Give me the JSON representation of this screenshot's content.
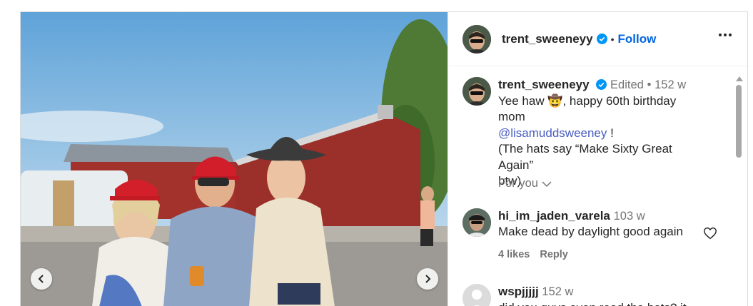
{
  "post": {
    "username": "trent_sweeneyy",
    "dot": "•",
    "follow_label": "Follow"
  },
  "caption": {
    "username": "trent_sweeneyy",
    "edited": "Edited",
    "dot": "•",
    "age": "152 w",
    "text_1": "Yee haw 🤠, happy 60th birthday mom",
    "mention": "@lisamuddsweeney",
    "text_2": " !",
    "text_3": "(The hats say “Make Sixty Great Again”",
    "text_4": "btw)"
  },
  "for_you": "For you",
  "comments": [
    {
      "username": "hi_im_jaden_varela",
      "age": "103 w",
      "text": "Make dead by daylight good again",
      "likes": "4 likes",
      "reply": "Reply"
    },
    {
      "username": "wspjjjjj",
      "age": "152 w",
      "text": "did you guys even read the hats? it"
    }
  ],
  "colors": {
    "follow": "#0064e0",
    "mention": "#4a5ec0",
    "verified": "#0095f6"
  }
}
